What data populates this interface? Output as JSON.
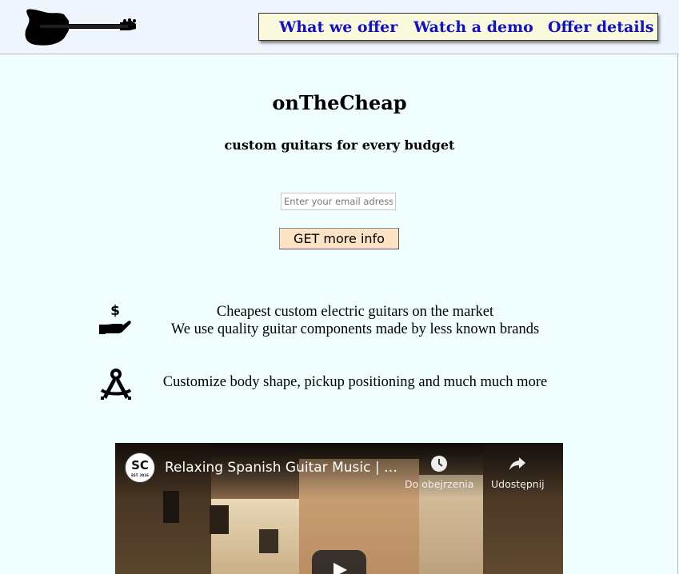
{
  "header": {
    "logo_icon": "electric-guitar-silhouette",
    "nav": [
      {
        "label": "What we offer"
      },
      {
        "label": "Watch a demo"
      },
      {
        "label": "Offer details"
      }
    ]
  },
  "hero": {
    "title": "onTheCheap",
    "subtitle": "custom guitars for every budget",
    "email_placeholder": "Enter your email adress",
    "cta_label": "GET more info"
  },
  "features": [
    {
      "icon": "hand-holding-dollar-icon",
      "lines": [
        "Cheapest custom electric guitars on the market",
        "We use quality guitar components made by less known brands"
      ]
    },
    {
      "icon": "drafting-compass-icon",
      "lines": [
        "Customize body shape, pickup positioning and much much more"
      ]
    }
  ],
  "video": {
    "channel_badge": "SC",
    "channel_badge_small": "EST. 2016",
    "title": "Relaxing Spanish Guitar Music | Gu...",
    "watch_later": "Do obejrzenia",
    "share": "Udostępnij"
  },
  "colors": {
    "page_bg": "#f0feff",
    "header_bg": "#eef5fd",
    "nav_bg": "#fbf9dc",
    "nav_link": "#1010cc",
    "cta_bg": "#fde3c6"
  }
}
